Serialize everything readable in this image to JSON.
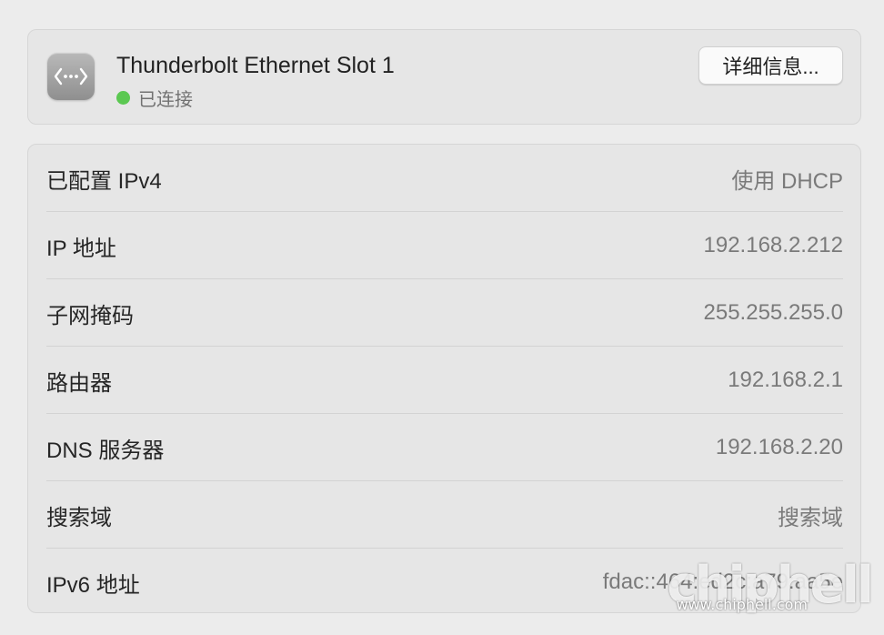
{
  "header": {
    "icon": "ethernet-icon",
    "service_name": "Thunderbolt Ethernet Slot 1",
    "status_text": "已连接",
    "status_color": "#5bc851",
    "details_label": "详细信息..."
  },
  "info_rows": [
    {
      "label": "已配置 IPv4",
      "value": "使用 DHCP"
    },
    {
      "label": "IP 地址",
      "value": "192.168.2.212"
    },
    {
      "label": "子网掩码",
      "value": "255.255.255.0"
    },
    {
      "label": "路由器",
      "value": "192.168.2.1"
    },
    {
      "label": "DNS 服务器",
      "value": "192.168.2.20"
    },
    {
      "label": "搜索域",
      "value": "搜索域"
    },
    {
      "label": "IPv6 地址",
      "value": "fdac::464:ed2c:a79:aa5e"
    }
  ],
  "watermark": {
    "logo": "chiphell",
    "url": "www.chiphell.com"
  }
}
